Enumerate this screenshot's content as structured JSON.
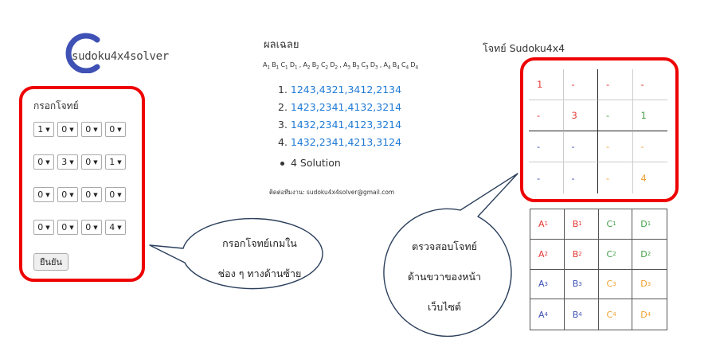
{
  "logo": {
    "text": "sudoku4x4solver",
    "color": "#3f51b5"
  },
  "form": {
    "title": "กรอกโจทย์",
    "rows": [
      [
        "1",
        "0",
        "0",
        "0"
      ],
      [
        "0",
        "3",
        "0",
        "1"
      ],
      [
        "0",
        "0",
        "0",
        "0"
      ],
      [
        "0",
        "0",
        "0",
        "4"
      ]
    ],
    "confirm_label": "ยืนยัน"
  },
  "solution": {
    "title": "ผลเฉลย",
    "formula": [
      {
        "letters": "A",
        "sub": "1"
      },
      {
        "letters": "B",
        "sub": "1"
      },
      {
        "letters": "C",
        "sub": "1"
      },
      {
        "letters": "D",
        "sub": "1"
      },
      {
        "letters": "A",
        "sub": "2"
      },
      {
        "letters": "B",
        "sub": "2"
      },
      {
        "letters": "C",
        "sub": "2"
      },
      {
        "letters": "D",
        "sub": "2"
      },
      {
        "letters": "A",
        "sub": "3"
      },
      {
        "letters": "B",
        "sub": "3"
      },
      {
        "letters": "C",
        "sub": "3"
      },
      {
        "letters": "D",
        "sub": "3"
      },
      {
        "letters": "A",
        "sub": "4"
      },
      {
        "letters": "B",
        "sub": "4"
      },
      {
        "letters": "C",
        "sub": "4"
      },
      {
        "letters": "D",
        "sub": "4"
      }
    ],
    "answers": [
      "1243,4321,3412,2134",
      "1423,2341,4132,3214",
      "1432,2341,4123,3214",
      "1432,2341,4213,3124"
    ],
    "count_label": "4 Solution",
    "contact": "ติดต่อทีมงาน: sudoku4x4solver@gmail.com"
  },
  "puzzle": {
    "title": "โจทย์ Sudoku4x4",
    "cells": [
      [
        "1",
        "-",
        "-",
        "-"
      ],
      [
        "-",
        "3",
        "-",
        "1"
      ],
      [
        "-",
        "-",
        "-",
        "-"
      ],
      [
        "-",
        "-",
        "-",
        "4"
      ]
    ],
    "row_colors": [
      "#e53935",
      "#e53935",
      "#3f51b5",
      "#3f51b5"
    ],
    "col_colors": [
      "#e53935",
      "#e53935",
      "#43a047",
      "#43a047"
    ],
    "value_colors": {
      "r0": [
        "#e53935",
        "#e53935",
        "#e53935",
        "#e53935"
      ],
      "r1": [
        "#e53935",
        "#e53935",
        "#43a047",
        "#43a047"
      ],
      "r2": [
        "#3f51b5",
        "#3f51b5",
        "#f0a030",
        "#f0a030"
      ],
      "r3": [
        "#3f51b5",
        "#3f51b5",
        "#f0a030",
        "#f0a030"
      ]
    }
  },
  "map": {
    "rows": [
      [
        {
          "l": "A",
          "s": "1"
        },
        {
          "l": "B",
          "s": "1"
        },
        {
          "l": "C",
          "s": "1"
        },
        {
          "l": "D",
          "s": "1"
        }
      ],
      [
        {
          "l": "A",
          "s": "2"
        },
        {
          "l": "B",
          "s": "2"
        },
        {
          "l": "C",
          "s": "2"
        },
        {
          "l": "D",
          "s": "2"
        }
      ],
      [
        {
          "l": "A",
          "s": "3"
        },
        {
          "l": "B",
          "s": "3"
        },
        {
          "l": "C",
          "s": "3"
        },
        {
          "l": "D",
          "s": "3"
        }
      ],
      [
        {
          "l": "A",
          "s": "4"
        },
        {
          "l": "B",
          "s": "4"
        },
        {
          "l": "C",
          "s": "4"
        },
        {
          "l": "D",
          "s": "4"
        }
      ]
    ],
    "colors": [
      [
        "#e53935",
        "#e53935",
        "#43a047",
        "#43a047"
      ],
      [
        "#e53935",
        "#e53935",
        "#43a047",
        "#43a047"
      ],
      [
        "#3f51b5",
        "#3f51b5",
        "#f0a030",
        "#f0a030"
      ],
      [
        "#3f51b5",
        "#3f51b5",
        "#f0a030",
        "#f0a030"
      ]
    ]
  },
  "callouts": {
    "left": [
      "กรอกโจทย์เกมใน",
      "ช่อง ๆ ทางด้านซ้าย"
    ],
    "right": [
      "ตรวจสอบโจทย์",
      "ด้านขวาของหน้า",
      "เว็บไซต์"
    ]
  },
  "highlight_color": "#e00000"
}
